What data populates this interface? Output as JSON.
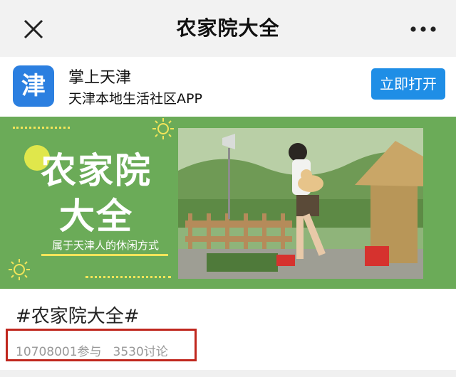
{
  "header": {
    "title": "农家院大全",
    "close_icon": "close-icon",
    "more_icon": "more-dots-icon"
  },
  "app_banner": {
    "icon_char": "津",
    "icon_color": "#2b7fe0",
    "name": "掌上天津",
    "description": "天津本地生活社区APP",
    "open_button": "立即打开",
    "button_color": "#1f8ee6"
  },
  "hero": {
    "title_line1": "农家院",
    "title_line2": "大全",
    "subtitle": "属于天津人的休闲方式",
    "background_color": "#6bab58",
    "accent_color": "#f3e55a"
  },
  "topic": {
    "hashtag": "#农家院大全#",
    "participants": "10708001参与",
    "discussions": "3530讨论"
  }
}
